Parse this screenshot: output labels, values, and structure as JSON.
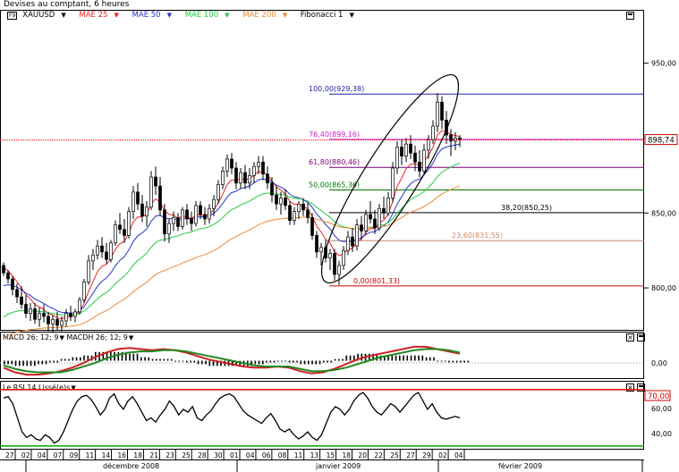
{
  "header": {
    "title": "Devises au comptant, 6 heures",
    "symbol_box": "F9",
    "symbol": "XAUUSD",
    "legend": [
      {
        "label": "MAE 25",
        "color": "#ee2222"
      },
      {
        "label": "MAE 50",
        "color": "#2233cc"
      },
      {
        "label": "MAE 100",
        "color": "#22cc44"
      },
      {
        "label": "MAE 200",
        "color": "#ee8833"
      },
      {
        "label": "Fibonacci 1",
        "color": "#000000"
      }
    ]
  },
  "chart_data": [
    {
      "type": "candlestick",
      "title": "XAUUSD",
      "y_ticks": [
        "950,00",
        "900,00",
        "850,00",
        "800,00"
      ],
      "ylim": [
        772,
        985
      ],
      "last_price": "898,74",
      "x_day_labels": [
        "27",
        "02",
        "04",
        "07",
        "09",
        "11",
        "14",
        "16",
        "18",
        "21",
        "23",
        "25",
        "28",
        "30",
        "01",
        "04",
        "06",
        "08",
        "11",
        "13",
        "15",
        "18",
        "20",
        "22",
        "25",
        "27",
        "29",
        "02",
        "04"
      ],
      "x_month_labels": [
        "décembre 2008",
        "janvier 2009",
        "février 2009"
      ],
      "fibonacci": [
        {
          "label": "100,00(929,38)",
          "value": 929.38,
          "color": "#2222aa"
        },
        {
          "label": "76,40(899,16)",
          "value": 899.16,
          "color": "#cc22cc"
        },
        {
          "label": "61,80(880,46)",
          "value": 880.46,
          "color": "#770077"
        },
        {
          "label": "50,00(865,36)",
          "value": 865.36,
          "color": "#007700"
        },
        {
          "label": "38,20(850,25)",
          "value": 850.25,
          "color": "#000000"
        },
        {
          "label": "23,60(831,55)",
          "value": 831.55,
          "color": "#cc8866"
        },
        {
          "label": "0,00(801,33)",
          "value": 801.33,
          "color": "#cc0000"
        }
      ],
      "candles": [
        [
          815,
          817,
          808,
          810
        ],
        [
          810,
          812,
          803,
          806
        ],
        [
          806,
          808,
          795,
          799
        ],
        [
          799,
          803,
          790,
          794
        ],
        [
          794,
          801,
          786,
          789
        ],
        [
          789,
          795,
          780,
          783
        ],
        [
          783,
          790,
          778,
          786
        ],
        [
          786,
          790,
          776,
          779
        ],
        [
          779,
          787,
          774,
          783
        ],
        [
          783,
          789,
          777,
          781
        ],
        [
          781,
          784,
          771,
          776
        ],
        [
          776,
          782,
          770,
          779
        ],
        [
          779,
          784,
          772,
          775
        ],
        [
          775,
          781,
          771,
          778
        ],
        [
          778,
          786,
          774,
          783
        ],
        [
          783,
          788,
          778,
          781
        ],
        [
          781,
          786,
          777,
          784
        ],
        [
          784,
          794,
          782,
          792
        ],
        [
          792,
          806,
          790,
          804
        ],
        [
          804,
          822,
          802,
          818
        ],
        [
          818,
          826,
          812,
          822
        ],
        [
          822,
          832,
          819,
          828
        ],
        [
          828,
          834,
          820,
          824
        ],
        [
          824,
          830,
          816,
          819
        ],
        [
          819,
          832,
          817,
          830
        ],
        [
          830,
          845,
          828,
          842
        ],
        [
          842,
          850,
          836,
          839
        ],
        [
          839,
          846,
          830,
          835
        ],
        [
          835,
          854,
          833,
          851
        ],
        [
          851,
          868,
          846,
          864
        ],
        [
          864,
          870,
          852,
          856
        ],
        [
          856,
          862,
          844,
          848
        ],
        [
          848,
          858,
          841,
          854
        ],
        [
          854,
          878,
          852,
          874
        ],
        [
          874,
          881,
          862,
          868
        ],
        [
          868,
          874,
          848,
          852
        ],
        [
          852,
          856,
          831,
          836
        ],
        [
          836,
          846,
          830,
          843
        ],
        [
          843,
          851,
          838,
          847
        ],
        [
          847,
          850,
          838,
          841
        ],
        [
          841,
          854,
          839,
          852
        ],
        [
          852,
          856,
          842,
          846
        ],
        [
          846,
          851,
          838,
          843
        ],
        [
          843,
          858,
          841,
          855
        ],
        [
          855,
          858,
          846,
          849
        ],
        [
          849,
          854,
          842,
          846
        ],
        [
          846,
          856,
          843,
          853
        ],
        [
          853,
          862,
          848,
          859
        ],
        [
          859,
          872,
          856,
          869
        ],
        [
          869,
          881,
          866,
          878
        ],
        [
          878,
          889,
          874,
          886
        ],
        [
          886,
          890,
          876,
          880
        ],
        [
          880,
          884,
          866,
          870
        ],
        [
          870,
          880,
          866,
          877
        ],
        [
          877,
          882,
          866,
          870
        ],
        [
          870,
          880,
          866,
          875
        ],
        [
          875,
          884,
          870,
          881
        ],
        [
          881,
          888,
          876,
          884
        ],
        [
          884,
          888,
          872,
          876
        ],
        [
          876,
          881,
          866,
          870
        ],
        [
          870,
          874,
          857,
          862
        ],
        [
          862,
          868,
          852,
          856
        ],
        [
          856,
          864,
          849,
          860
        ],
        [
          860,
          866,
          852,
          855
        ],
        [
          855,
          858,
          842,
          845
        ],
        [
          845,
          854,
          842,
          851
        ],
        [
          851,
          858,
          846,
          856
        ],
        [
          856,
          860,
          848,
          852
        ],
        [
          852,
          857,
          843,
          847
        ],
        [
          847,
          850,
          832,
          835
        ],
        [
          835,
          838,
          820,
          824
        ],
        [
          824,
          830,
          815,
          827
        ],
        [
          827,
          832,
          817,
          820
        ],
        [
          820,
          826,
          812,
          823
        ],
        [
          823,
          826,
          805,
          809
        ],
        [
          809,
          818,
          802,
          815
        ],
        [
          815,
          828,
          812,
          825
        ],
        [
          825,
          838,
          822,
          834
        ],
        [
          834,
          840,
          824,
          828
        ],
        [
          828,
          846,
          825,
          842
        ],
        [
          842,
          848,
          832,
          838
        ],
        [
          838,
          852,
          836,
          849
        ],
        [
          849,
          858,
          843,
          846
        ],
        [
          846,
          852,
          836,
          840
        ],
        [
          840,
          856,
          838,
          853
        ],
        [
          853,
          861,
          846,
          850
        ],
        [
          850,
          864,
          848,
          860
        ],
        [
          860,
          884,
          857,
          880
        ],
        [
          880,
          898,
          876,
          894
        ],
        [
          894,
          899,
          882,
          888
        ],
        [
          888,
          900,
          884,
          896
        ],
        [
          896,
          902,
          886,
          890
        ],
        [
          890,
          895,
          878,
          884
        ],
        [
          884,
          892,
          874,
          878
        ],
        [
          878,
          896,
          876,
          892
        ],
        [
          892,
          902,
          886,
          899
        ],
        [
          899,
          912,
          896,
          908
        ],
        [
          908,
          930,
          904,
          924
        ],
        [
          924,
          928,
          906,
          912
        ],
        [
          912,
          918,
          896,
          902
        ],
        [
          902,
          906,
          888,
          898
        ],
        [
          898,
          904,
          892,
          900
        ],
        [
          900,
          902,
          894,
          899
        ]
      ],
      "moving_averages": [
        {
          "name": "MAE 25",
          "color": "#ee2222"
        },
        {
          "name": "MAE 50",
          "color": "#2233cc"
        },
        {
          "name": "MAE 100",
          "color": "#22cc44"
        },
        {
          "name": "MAE 200",
          "color": "#ee8833"
        }
      ]
    },
    {
      "type": "line",
      "title": "MACD 26; 12; 9",
      "histogram_label": "MACDH 26; 12; 9",
      "y_ticks": [
        "0,00"
      ],
      "ylim": [
        -15,
        15
      ],
      "series": [
        {
          "name": "MACD 26; 12; 9",
          "color": "#cc2222",
          "values": [
            -6,
            -10,
            -12,
            -12,
            -11,
            -9,
            -6,
            -2,
            3,
            7,
            10,
            11,
            10,
            9,
            10,
            9,
            7,
            4,
            1,
            -1,
            -3,
            -5,
            -6,
            -6,
            -5,
            -6,
            -9,
            -11,
            -10,
            -7,
            -3,
            1,
            4,
            6,
            8,
            10,
            12,
            12,
            10,
            8,
            6
          ]
        },
        {
          "name": "Signal",
          "color": "#228822",
          "values": [
            -4,
            -7,
            -9,
            -10,
            -10,
            -10,
            -8,
            -5,
            -2,
            2,
            5,
            7,
            8,
            8,
            9,
            9,
            8,
            6,
            4,
            2,
            0,
            -2,
            -4,
            -5,
            -5,
            -5,
            -7,
            -9,
            -9,
            -8,
            -6,
            -3,
            0,
            3,
            5,
            7,
            9,
            10,
            10,
            9,
            7
          ]
        }
      ]
    },
    {
      "type": "line",
      "title": "Le RSI 14 Lissé(e)s",
      "y_ticks": [
        "60,00",
        "40,00"
      ],
      "overbought_label": "70,00",
      "levels": [
        70,
        30
      ],
      "ylim": [
        28,
        75
      ],
      "series": [
        {
          "name": "Le RSI 14 Lissé(e)s",
          "color": "#000000",
          "values": [
            64,
            65,
            60,
            50,
            40,
            36,
            38,
            35,
            34,
            38,
            36,
            32,
            34,
            40,
            48,
            56,
            62,
            65,
            66,
            63,
            58,
            52,
            56,
            64,
            67,
            60,
            56,
            62,
            65,
            60,
            54,
            48,
            50,
            47,
            52,
            56,
            62,
            58,
            52,
            56,
            54,
            58,
            50,
            48,
            52,
            55,
            60,
            64,
            66,
            67,
            65,
            60,
            55,
            52,
            50,
            48,
            46,
            50,
            53,
            48,
            42,
            40,
            42,
            38,
            35,
            37,
            40,
            36,
            34,
            38,
            46,
            54,
            58,
            56,
            52,
            56,
            62,
            66,
            68,
            64,
            58,
            54,
            52,
            56,
            60,
            58,
            54,
            58,
            62,
            66,
            68,
            62,
            56,
            60,
            54,
            50,
            49,
            50,
            51,
            50
          ]
        }
      ]
    }
  ]
}
